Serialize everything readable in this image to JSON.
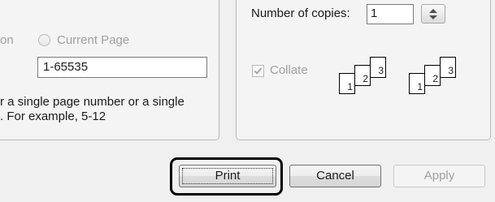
{
  "range": {
    "selection_fragment": "on",
    "current_page_label": "Current Page",
    "pages_value": "1-65535",
    "hint_line1": "r a single page number or a single",
    "hint_line2": ".  For example, 5-12"
  },
  "copies": {
    "label": "Number of copies:",
    "value": "1",
    "collate_label": "Collate",
    "collate_checked": true,
    "set1_pages": [
      "1",
      "2",
      "3"
    ],
    "set2_pages": [
      "1",
      "2",
      "3"
    ]
  },
  "buttons": {
    "print": "Print",
    "cancel": "Cancel",
    "apply": "Apply"
  }
}
